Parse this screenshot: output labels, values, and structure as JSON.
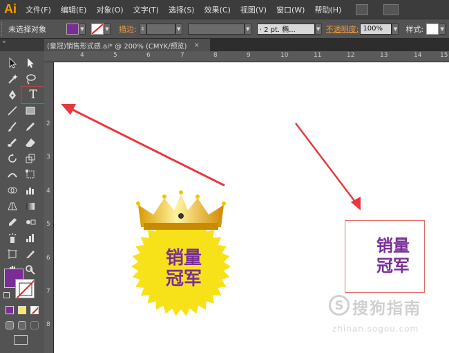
{
  "app": {
    "logo": "Ai"
  },
  "menu": [
    "文件(F)",
    "编辑(E)",
    "对象(O)",
    "文字(T)",
    "选择(S)",
    "效果(C)",
    "视图(V)",
    "窗口(W)",
    "帮助(H)"
  ],
  "control_bar": {
    "selection_status": "未选择对象",
    "stroke_label": "描边:",
    "brush_value": "· 2 pt. 椭...",
    "opacity_label": "不透明度:",
    "opacity_value": "100%",
    "style_label": "样式:",
    "fill_color": "#7b2d96"
  },
  "document_tab": {
    "title": "(皇冠)销售形式感.ai* @ 200% (CMYK/预览)",
    "close": "×"
  },
  "toolbar": {
    "header": "«"
  },
  "ruler": {
    "top": [
      "4",
      "5",
      "6",
      "7",
      "8",
      "9",
      "10",
      "11",
      "12",
      "13",
      "14",
      "15"
    ],
    "left": [
      "2",
      "3",
      "4",
      "5",
      "6",
      "7",
      "8"
    ]
  },
  "canvas": {
    "badge": {
      "line1": "销量",
      "line2": "冠军"
    },
    "textbox": {
      "line1": "销量",
      "line2": "冠军"
    }
  },
  "watermark": {
    "logo": "S",
    "text": "搜狗指南",
    "url": "zhinan.sogou.com"
  },
  "colors": {
    "accent_purple": "#7b2d96",
    "annotation_red": "#e8383d",
    "badge_yellow": "#f7e21a"
  }
}
